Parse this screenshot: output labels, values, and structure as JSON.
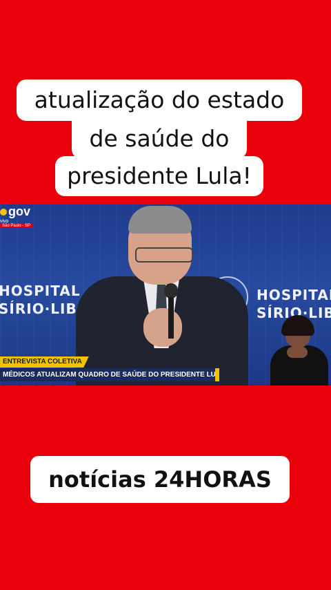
{
  "headline": {
    "line1": "atualização do estado",
    "line2": "de saúde do",
    "line3": "presidente Lula!"
  },
  "video": {
    "broadcaster": "gov",
    "live_label": "vivo",
    "location": "São Paulo - SP",
    "backdrop_left": [
      "HOSPITAL",
      "SÍRIO·LIBANÊS"
    ],
    "backdrop_right": [
      "HOSPITAL",
      "SÍRIO·LIBANÊS"
    ],
    "lower_third_top": "ENTREVISTA COLETIVA",
    "lower_third_bottom": "MÉDICOS ATUALIZAM QUADRO DE SAÚDE DO PRESIDENTE LULA"
  },
  "caption": "notícias 24HORAS",
  "colors": {
    "background": "#e8000b",
    "accent": "#f2c200",
    "banner": "#1b2b5e"
  }
}
